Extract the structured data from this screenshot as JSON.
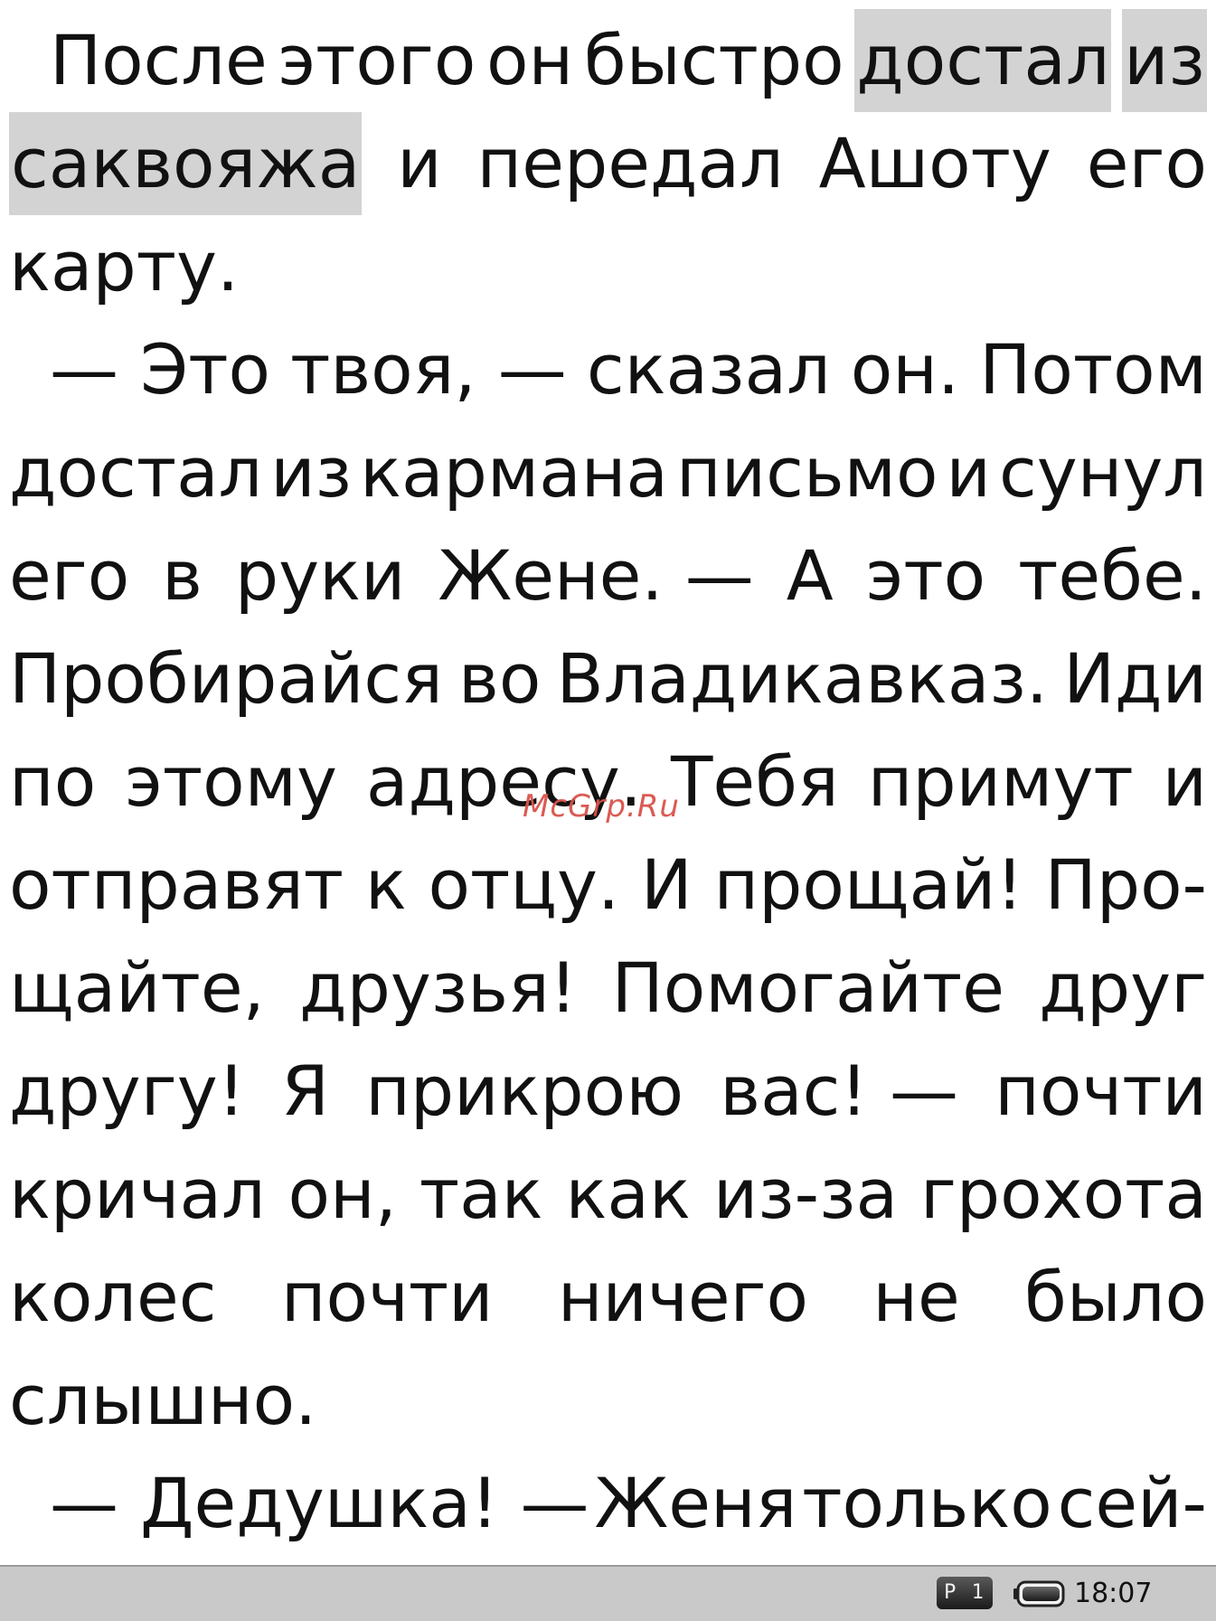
{
  "book_text": {
    "lines": [
      [
        "После",
        "этого",
        "он",
        "быстро",
        "достал",
        "из"
      ],
      [
        "саквояжа",
        "и",
        "передал",
        "Ашоту",
        "его"
      ],
      [
        "карту."
      ],
      [
        "— Это",
        "твоя, —",
        "сказал",
        "он.",
        "Потом"
      ],
      [
        "достал",
        "из",
        "кармана",
        "письмо",
        "и",
        "сунул"
      ],
      [
        "его",
        "в",
        "руки",
        "Жене. —",
        "А",
        "это",
        "тебе."
      ],
      [
        "Пробирайся",
        "во",
        "Владикавказ.",
        "Иди"
      ],
      [
        "по",
        "этому",
        "адресу.",
        "Тебя",
        "примут",
        "и"
      ],
      [
        "отправят",
        "к",
        "отцу.",
        "И",
        "прощай!",
        "Про-"
      ],
      [
        "щайте,",
        "друзья!",
        "Помогайте",
        "друг"
      ],
      [
        "другу!",
        "Я",
        "прикрою",
        "вас! —",
        "почти"
      ],
      [
        "кричал",
        "он,",
        "так",
        "как",
        "из-за",
        "грохота"
      ],
      [
        "колес",
        "почти",
        "ничего",
        "не",
        "было"
      ],
      [
        "слышно."
      ],
      [
        "— Дедушка! —",
        "Женя",
        "только",
        "сей-"
      ]
    ]
  },
  "watermark": "McGrp.Ru",
  "status_bar": {
    "page_indicator": "P 1",
    "battery_icon": "battery-icon",
    "clock": "18:07"
  }
}
